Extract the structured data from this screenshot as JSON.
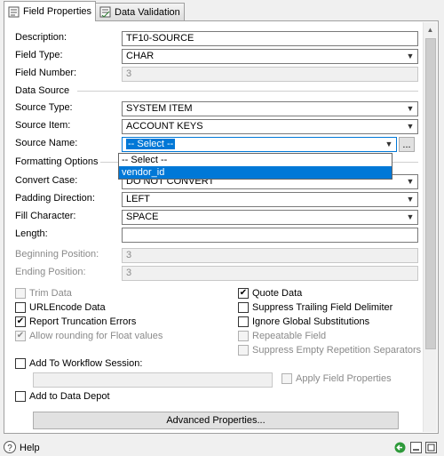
{
  "tabs": [
    {
      "label": "Field Properties",
      "active": true
    },
    {
      "label": "Data Validation",
      "active": false
    }
  ],
  "form": {
    "description": {
      "label": "Description:",
      "value": "TF10-SOURCE"
    },
    "field_type": {
      "label": "Field Type:",
      "value": "CHAR"
    },
    "field_number": {
      "label": "Field Number:",
      "value": "3"
    },
    "data_source_group": "Data Source",
    "source_type": {
      "label": "Source Type:",
      "value": "SYSTEM ITEM"
    },
    "source_item": {
      "label": "Source Item:",
      "value": "ACCOUNT KEYS"
    },
    "source_name": {
      "label": "Source Name:",
      "value": "-- Select --",
      "browse": "..."
    },
    "source_name_options": [
      "-- Select --",
      "vendor_id"
    ],
    "formatting_group": "Formatting Options",
    "convert_case": {
      "label": "Convert Case:",
      "value": "DO NOT CONVERT"
    },
    "padding_direction": {
      "label": "Padding Direction:",
      "value": "LEFT"
    },
    "fill_character": {
      "label": "Fill Character:",
      "value": "SPACE"
    },
    "length": {
      "label": "Length:",
      "value": ""
    },
    "beginning_position": {
      "label": "Beginning Position:",
      "value": "3"
    },
    "ending_position": {
      "label": "Ending Position:",
      "value": "3"
    }
  },
  "checkboxes": {
    "trim_data": {
      "label": "Trim Data",
      "checked": false
    },
    "urlencode_data": {
      "label": "URLEncode Data",
      "checked": false
    },
    "report_truncation": {
      "label": "Report Truncation Errors",
      "checked": true
    },
    "allow_rounding": {
      "label": "Allow rounding for Float values",
      "checked": true
    },
    "quote_data": {
      "label": "Quote Data",
      "checked": true
    },
    "suppress_trailing": {
      "label": "Suppress Trailing Field Delimiter",
      "checked": false
    },
    "ignore_global": {
      "label": "Ignore Global Substitutions",
      "checked": false
    },
    "repeatable_field": {
      "label": "Repeatable Field",
      "checked": false
    },
    "suppress_empty_rep": {
      "label": "Suppress Empty Repetition Separators",
      "checked": false
    },
    "add_workflow": {
      "label": "Add To Workflow Session:",
      "checked": false
    },
    "apply_field_props": {
      "label": "Apply Field Properties",
      "checked": false
    },
    "add_data_depot": {
      "label": "Add to Data Depot",
      "checked": false
    }
  },
  "buttons": {
    "advanced_properties": "Advanced Properties..."
  },
  "statusbar": {
    "help": "Help"
  },
  "colors": {
    "selection": "#0078d7",
    "ok_icon": "#2e9a3a"
  }
}
